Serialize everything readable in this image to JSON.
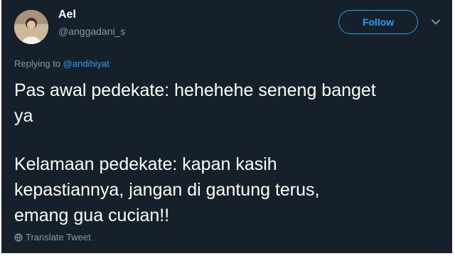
{
  "user": {
    "name": "Ael",
    "handle": "@anggadani_s"
  },
  "follow_label": "Follow",
  "reply": {
    "prefix": "Replying to",
    "mention": "@andihiyat"
  },
  "tweet": {
    "lines": [
      "Pas awal pedekate: hehehehe seneng banget",
      "ya",
      "Kelamaan pedekate: kapan kasih",
      "kepastiannya, jangan di gantung terus,",
      "emang gua cucian!!"
    ]
  },
  "translate_label": "Translate Tweet",
  "colors": {
    "background": "#15202b",
    "accent": "#1da1f2",
    "muted": "#8899a6",
    "text": "#ffffff"
  },
  "icons": {
    "caret": "chevron-down-icon",
    "translate": "globe-icon"
  }
}
